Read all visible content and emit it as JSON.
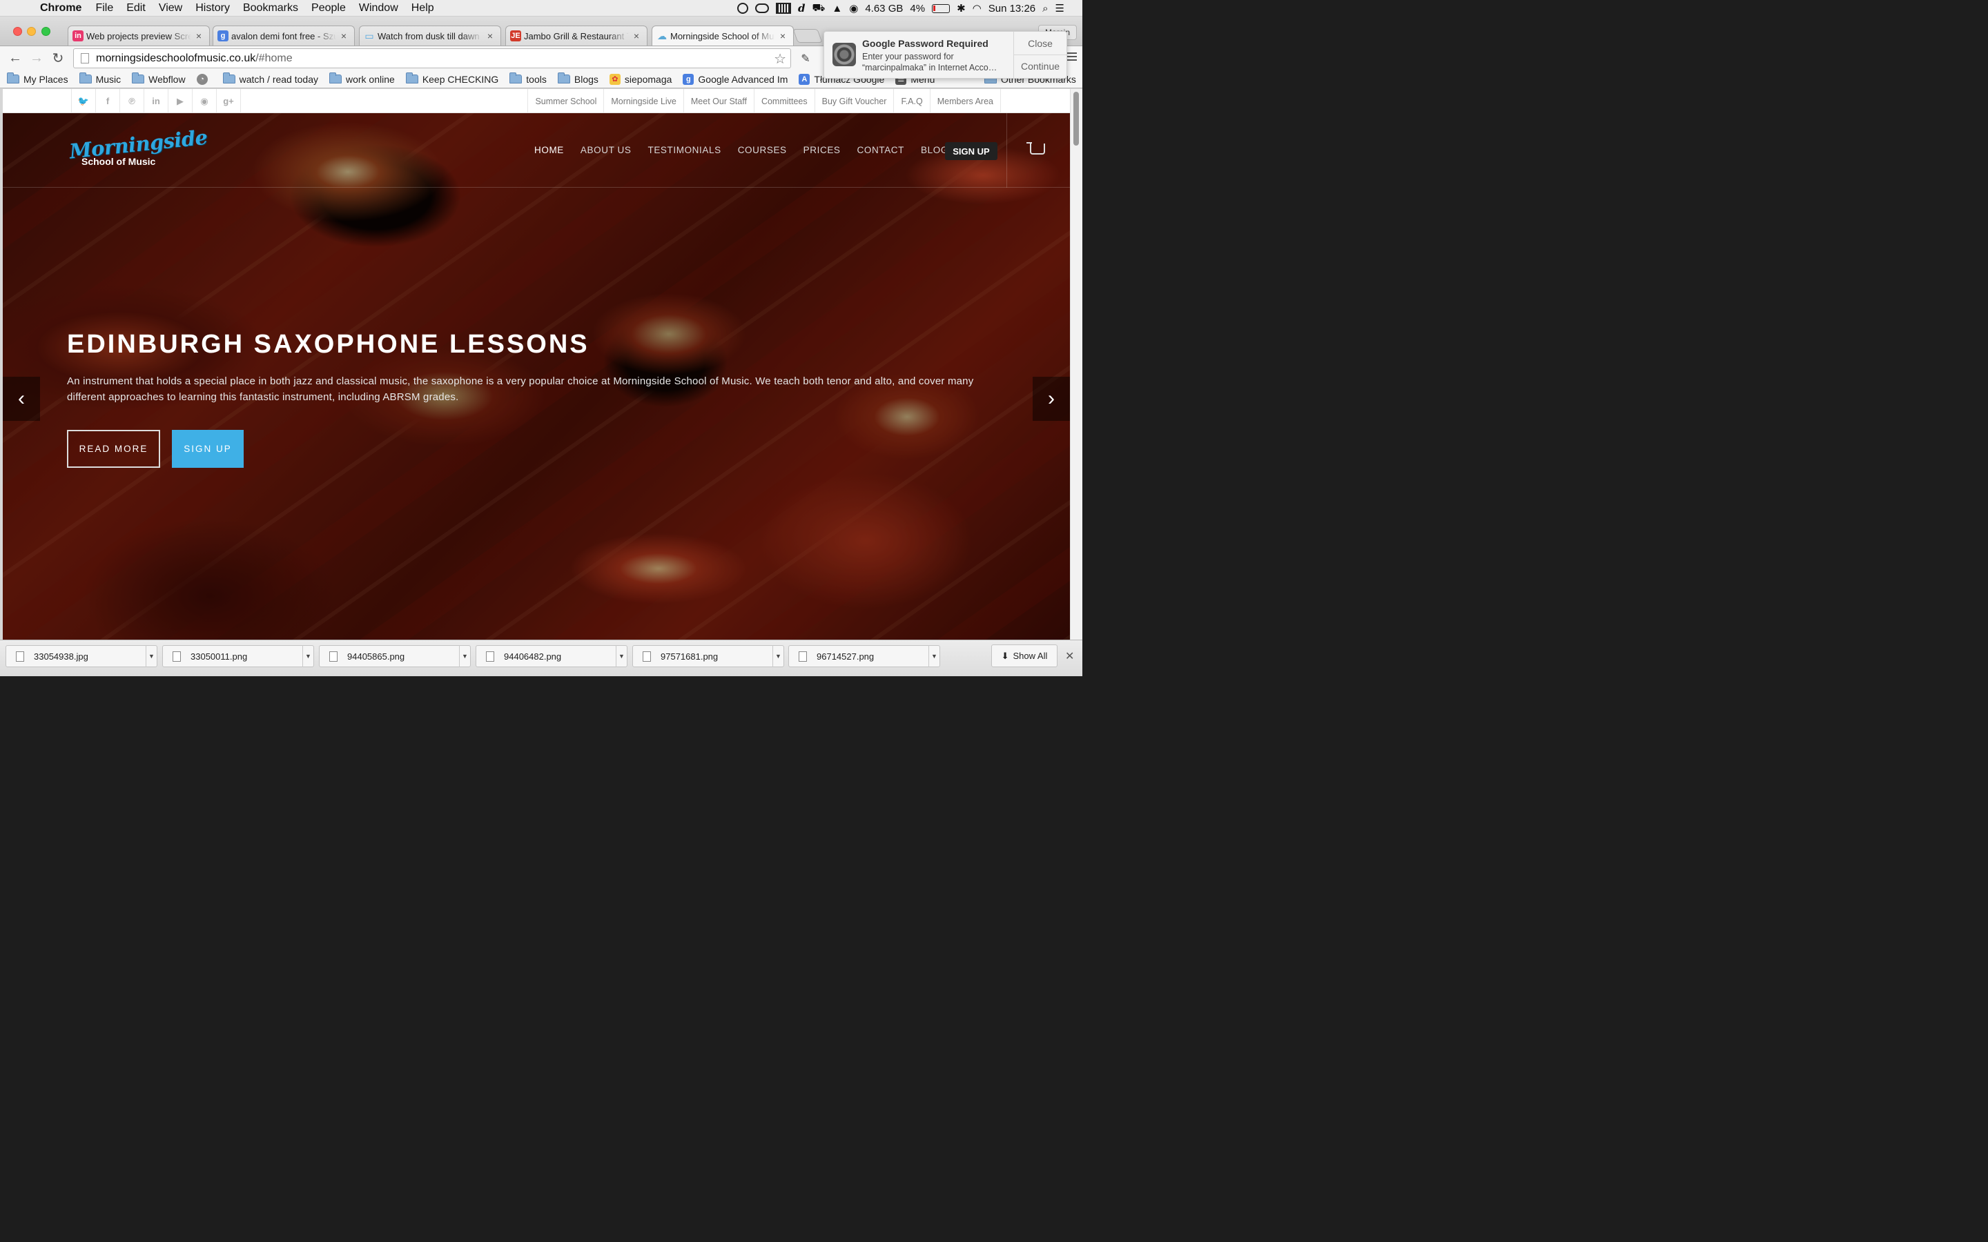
{
  "menubar": {
    "app": "Chrome",
    "menus": [
      "File",
      "Edit",
      "View",
      "History",
      "Bookmarks",
      "People",
      "Window",
      "Help"
    ],
    "memory": "4.63 GB",
    "battery": "4%",
    "clock": "Sun 13:26"
  },
  "tabs": [
    {
      "title": "Web projects preview Scre",
      "favicon": "in",
      "color": "#e8386d"
    },
    {
      "title": "avalon demi font free - Szu",
      "favicon": "g",
      "color": "#4a7fe0"
    },
    {
      "title": "Watch from dusk till dawn",
      "favicon": "▭",
      "color": "#4fa6e0"
    },
    {
      "title": "Jambo Grill & Restaurant T",
      "favicon": "JE",
      "color": "#d23a2a"
    },
    {
      "title": "Morningside School of Mu",
      "favicon": "☁",
      "color": "#8ec6e8"
    }
  ],
  "profile_label": "Marcin",
  "omnibox": {
    "host": "morningsideschoolofmusic.co.uk",
    "path": "/#home"
  },
  "bookmarks": [
    {
      "label": "My Places",
      "type": "folder"
    },
    {
      "label": "Music",
      "type": "folder"
    },
    {
      "label": "Webflow",
      "type": "folder"
    },
    {
      "label": "",
      "type": "ghost"
    },
    {
      "label": "watch / read today",
      "type": "folder"
    },
    {
      "label": "work online",
      "type": "folder"
    },
    {
      "label": "Keep CHECKING",
      "type": "folder"
    },
    {
      "label": "tools",
      "type": "folder"
    },
    {
      "label": "Blogs",
      "type": "folder"
    },
    {
      "label": "siepomaga",
      "type": "popcorn"
    },
    {
      "label": "Google Advanced Im",
      "type": "google"
    },
    {
      "label": "Tłumacz Google",
      "type": "translate"
    },
    {
      "label": "Menu",
      "type": "menu"
    }
  ],
  "bookmarks_other": "Other Bookmarks",
  "notification": {
    "title": "Google Password Required",
    "body": "Enter your password for “marcinpalmaka” in Internet Acco…",
    "close": "Close",
    "continue": "Continue"
  },
  "site": {
    "social": [
      "twitter",
      "facebook",
      "pinterest",
      "linkedin",
      "youtube",
      "rss",
      "google-plus"
    ],
    "social_glyphs": [
      "🐦",
      "f",
      "℗",
      "in",
      "▶",
      "◉",
      "g+"
    ],
    "top_links": [
      "Summer School",
      "Morningside Live",
      "Meet Our Staff",
      "Committees",
      "Buy Gift Voucher",
      "F.A.Q",
      "Members Area"
    ],
    "logo": {
      "line1": "Morningside",
      "line2": "School of Music"
    },
    "nav": [
      "HOME",
      "ABOUT US",
      "TESTIMONIALS",
      "COURSES",
      "PRICES",
      "CONTACT",
      "BLOG"
    ],
    "nav_signup": "SIGN UP",
    "slide": {
      "title": "EDINBURGH SAXOPHONE LESSONS",
      "description": "An instrument that holds a special place in both jazz and classical music, the saxophone is a very popular choice at Morningside School of Music. We teach both tenor and alto, and cover many different approaches to learning this fantastic instrument, including ABRSM grades.",
      "read_more": "READ MORE",
      "sign_up": "SIGN UP"
    },
    "accent": "#3fb0e6"
  },
  "downloads": [
    "33054938.jpg",
    "33050011.png",
    "94405865.png",
    "94406482.png",
    "97571681.png",
    "96714527.png"
  ],
  "show_all": "Show All"
}
